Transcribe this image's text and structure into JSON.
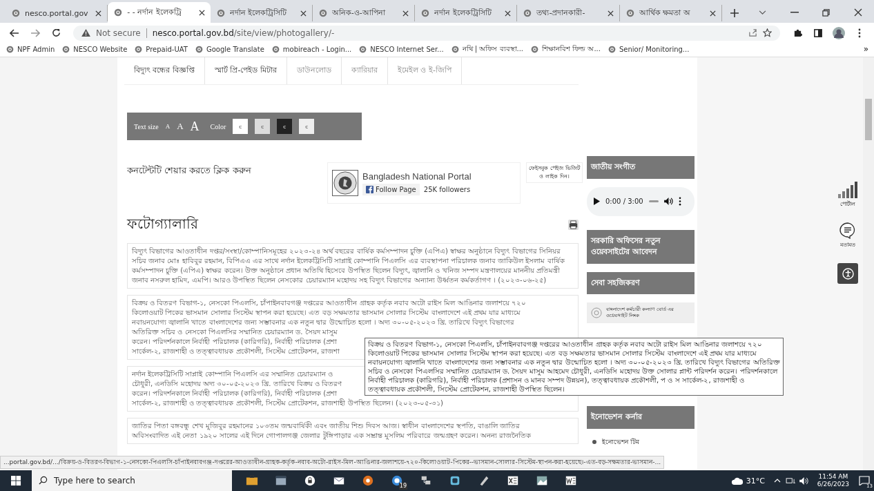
{
  "browser": {
    "tabs": [
      {
        "title": "nesco.portal.gov",
        "selected": false
      },
      {
        "title": "- - নর্দান ইলেকট্রি",
        "selected": true
      },
      {
        "title": "নর্দান ইলেকট্রিসিটি",
        "selected": false
      },
      {
        "title": "অনিক-ও-আপিনা",
        "selected": false
      },
      {
        "title": "নর্দান ইলেকট্রিসিটি",
        "selected": false
      },
      {
        "title": "তথ্য-প্রদানকারী-",
        "selected": false
      },
      {
        "title": "আর্থিক ক্ষমতা অ",
        "selected": false
      }
    ],
    "security": "Not secure",
    "url_host": "nesco.portal.gov.bd",
    "url_path": "/site/view/photogallery/-",
    "bookmarks": [
      {
        "label": "NPF Admin"
      },
      {
        "label": "NESCO Website"
      },
      {
        "label": "Prepaid-UAT"
      },
      {
        "label": "Google Translate"
      },
      {
        "label": "mobireach - Login..."
      },
      {
        "label": "NESCO Internet Ser..."
      },
      {
        "label": "নথি | অফিস ব্যবস্থা..."
      },
      {
        "label": "শিক্ষানবিশ ফিল্ড অ..."
      },
      {
        "label": "Senior/ Monitoring..."
      }
    ],
    "bookmarks_more": "»"
  },
  "page": {
    "nav": [
      "বিদ্যুৎ বন্ধের বিজ্ঞপ্তি",
      "স্মার্ট প্রি-পেইড মিটার",
      "ডাউনলোড",
      "ক্যারিয়ার",
      "ইমেইল ও ই-জিপি"
    ],
    "text_size": {
      "label": "Text size",
      "sizes": [
        "A",
        "A",
        "A"
      ]
    },
    "color": {
      "label": "Color",
      "swatches": [
        {
          "text": "c",
          "color": "#ffffff"
        },
        {
          "text": "c",
          "color": "#dcdcdc"
        },
        {
          "text": "c",
          "color": "#222222"
        },
        {
          "text": "c",
          "color": "#eeeeee"
        }
      ]
    },
    "share": "কনটেন্টটি শেয়ার করতে ক্লিক করুন",
    "facebook": {
      "name": "Bangladesh National Portal",
      "follow": "Follow Page",
      "followers": "25K followers",
      "note": "ফেইসবুক পেইজ ভিজিট ও লাইক দিন।"
    },
    "title": "ফটোগ্যালারি",
    "items": [
      {
        "kind": "text",
        "text": "বিদ্যুৎ বিভাগের আওতাধীন দপ্তর/সংস্থা/কোম্পানিসমূহের ২০২৩-২৪ অর্থ বছরের বার্ষিক কর্মসম্পাদন চুক্তি (এপিএ) স্বাক্ষর অনুষ্ঠানে বিদ্যুৎ বিভাগের সিনিয়র সচিব জনাব মোঃ হাবিবুর রহমান, বিপিএএ এর সাথে নর্দান ইলেকট্রিসিটি সাপ্লাই কোম্পানি পিএলসি এর ব্যবস্থাপনা পরিচালক জনাব জাকিউল ইসলাম বার্ষিক কর্মসম্পাদন চুক্তি (এপিএ) স্বাক্ষর করেন। উক্ত অনুষ্ঠানে প্রধান অতিথি হিসেবে উপস্থিত ছিলেন বিদ্যুৎ, জ্বালানি ও খনিজ সম্পদ মন্ত্রণালয়ের মাননীয় প্রতিমন্ত্রী জনাব নসরুল হামিদ, এমপি। আরও উপস্থিত ছিলেন নেসকোর চেয়ারম্যান মহোদয় সহ বিদ্যুৎ বিভাগের অন্যান্য উর্ধ্বতন কর্মকর্তাগণ । (২০২৩-০৬-২৫)"
      },
      {
        "kind": "lines",
        "lines": [
          "বিক্রয় ও বিতরণ বিভাগ-১, নেসকো পিএলসি, চাঁপাইনবাবগঞ্জ দপ্তরের আওতাধীন গ্রাহক কর্তৃক নবাব অটো রাইস মিল আঙিনার জলাশয়ে ৭২০",
          "কিলোওয়াট পিকের ভাসমান সোলার সিস্টেম স্থাপন করা হয়েছে। এত বড় সক্ষমতার ভাসমান সোলার সিস্টেম বাংলাদেশে এই প্রথম যার মাধ্যমে",
          "নবায়নযোগ্য জ্বালানি খাতে বাংলাদেশের জন্য সম্ভাবনার এক নতুন দ্বার উন্মোচিত হলো । অদ্য ৩০-০৫-২০২৩ খ্রি. তারিখে বিদ্যুৎ বিভাগের",
          "অতিরিক্ত সচিব ও নেসকো পিএলসির সম্মানিত চেয়ারম্যান ড. সৈয়দ মাসুম",
          "করেন। পরিদর্শনকালে নির্বাহী পরিচালক (কারিগরি), নির্বাহী পরিচালক (প্রশা",
          "সার্কেল-২, রাজশাহী ও তত্ত্বাবধায়ক প্রকৌশলী, সিস্টেম প্রোটেকশন, রাজশা"
        ]
      },
      {
        "kind": "lines",
        "lines": [
          "নর্দান ইলেকট্রিসিটি সাপ্লাই কোম্পানি পিএলসি এর সম্মানিত চেয়ারম্যান ও",
          "চৌধুরী, এনডিসি মহোদয় অদ্য ৩০-০৫-২০২৩ খ্রি. তারিখে বিক্রয় ও বিতরণ",
          "করেন। পরিদর্শনকালে নির্বাহী পরিচালক (কারিগরি), নির্বাহী পরিচালক (প্রশা",
          "সার্কেল-২, রাজশাহী ও তত্ত্বাবধায়ক প্রকৌশলী, সিস্টেম প্রোটেকশন, রাজশাহী উপস্থিত ছিলেন। (২০২৩-০৫-৩১)"
        ]
      },
      {
        "kind": "lines",
        "lines": [
          "জাতির পিতা বঙ্গবন্ধু শেখ মুজিবুর রহমানের ১০৩তম জন্মবার্ষিকী এবং জাতীয় শিশু দিবস আজ। স্বাধীন বাংলাদেশের স্থপতি, বাঙালি জাতির",
          "অবিসংবাদিত এই নেতা ১৯২০ সালের এই দিনে গোপালগঞ্জ জেলার টুঙ্গিপাড়ার এক সম্ভ্রান্ত মুসলিম পরিবারে জন্মগ্রহণ করেন। অনন্য রাজনৈতিক"
        ]
      }
    ],
    "tooltip": "বিক্রয় ও বিতরণ বিভাগ-১, নেসকো পিএলসি, চাঁপাইনবাবগঞ্জ দপ্তরের আওতাধীন গ্রাহক কর্তৃক নবাব অটো রাইস মিল আঙিনার জলাশয়ে ৭২০ কিলোওয়াট পিকের ভাসমান সোলার সিস্টেম স্থাপন করা হয়েছে। এত বড় সক্ষমতার ভাসমান সোলার সিস্টেম বাংলাদেশে এই প্রথম যার মাধ্যমে নবায়নযোগ্য জ্বালানি খাতে বাংলাদেশের জন্য সম্ভাবনার এক নতুন দ্বার উন্মোচিত হলো । অদ্য ৩০-০৫-২০২৩ খ্রি. তারিখে বিদ্যুৎ বিভাগের অতিরিক্ত সচিব ও নেসকো পিএলসির সম্মানিত চেয়ারম্যান ড. সৈয়দ মাসুম আহমেদ চৌধুরী, এনডিসি মহোদয় উক্ত সোলার প্লান্ট পরিদর্শন করেন। পরিদর্শনকালে নির্বাহী পরিচালক (কারিগরি), নির্বাহী পরিচালক (প্রশাসন ও মানব সম্পদ উন্নয়ন), তত্ত্বাবধায়ক প্রকৌশলী, প ও স সার্কেল-২, রাজশাহী ও তত্ত্বাবধায়ক প্রকৌশলী, সিস্টেম প্রোটেকশন, রাজশাহী উপস্থিত ছিলেন।",
    "sidebar": [
      {
        "kind": "heading",
        "text": "জাতীয় সংগীত"
      },
      {
        "kind": "audio",
        "time": "0:00 / 3:00"
      },
      {
        "kind": "heading",
        "text": "সরকারি অফিসের নতুন ওয়েবসাইটের আবেদন"
      },
      {
        "kind": "heading",
        "text": "সেবা সহজিকরণ"
      },
      {
        "kind": "banner",
        "text": "বাংলাদেশ কর্মচারী কল্যাণ বোর্ড এর ওয়েবসাইট লিংক"
      },
      {
        "kind": "heading",
        "text": "ইনোভেশন কর্নার"
      },
      {
        "kind": "link",
        "text": "ইনোভেশন টিম"
      }
    ],
    "side_tools": [
      {
        "kind": "signal",
        "label": "পোর্টাল"
      },
      {
        "kind": "feedback",
        "label": "মতামত"
      },
      {
        "kind": "accessibility"
      }
    ]
  },
  "status_url": "...portal.gov.bd/.../বিক্রয়-ও-বিতরণ-বিভাগ-১-নেসকো-পিএলসি-চাঁপাইনবাবগঞ্জ-দপ্তরের-আওতাধীন-গ্রাহক-কর্তৃক-নবাব-অটো-রাইস-মিল-আঙিনার-জলাশয়ে-৭২০-কিলোওয়াট-পিকের--ভাসমান-সোলার-সিস্টেম-স্থাপন-করা-হয়েছে।-এত-বড়-সক্ষমতার-ভাসমান-...",
  "taskbar": {
    "search_placeholder": "Type here to search",
    "app_badge": "19",
    "weather": "31°C",
    "time": "11:54 AM",
    "date": "6/26/2023",
    "notifications": "13"
  }
}
